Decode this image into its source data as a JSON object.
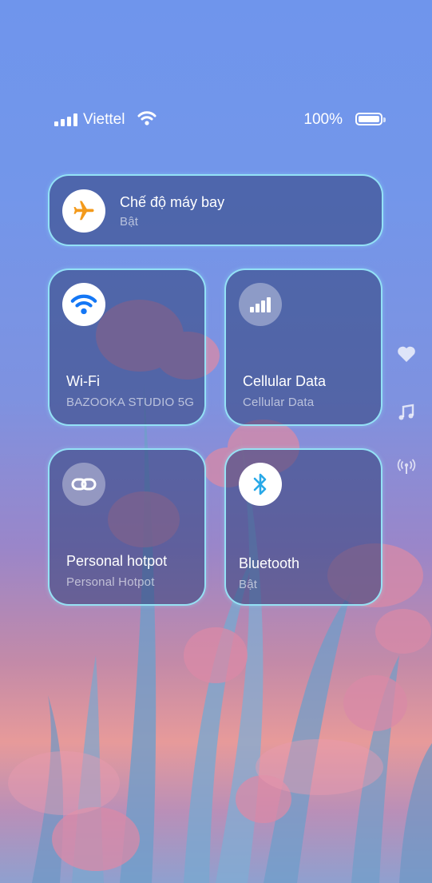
{
  "status_bar": {
    "carrier": "Viettel",
    "battery_percent": "100%",
    "battery_level": 1.0,
    "signal_bars": 4
  },
  "tiles": {
    "airplane": {
      "title": "Chế độ máy bay",
      "subtitle": "Bật",
      "icon": "airplane-icon",
      "icon_color": "#f39a1b"
    },
    "wifi": {
      "title": "Wi-Fi",
      "subtitle": "BAZOOKA STUDIO 5G",
      "icon": "wifi-icon",
      "icon_color": "#1477f5"
    },
    "cellular": {
      "title": "Cellular Data",
      "subtitle": "Cellular Data",
      "icon": "cellular-signal-icon"
    },
    "hotspot": {
      "title": "Personal hotpot",
      "subtitle": "Personal Hotpot",
      "icon": "link-icon"
    },
    "bluetooth": {
      "title": "Bluetooth",
      "subtitle": "Bật",
      "icon": "bluetooth-icon",
      "icon_color": "#29a9e8"
    }
  },
  "side_shortcuts": [
    "heart-icon",
    "music-note-icon",
    "broadcast-icon"
  ],
  "colors": {
    "tile_border": "#9bf0ff",
    "tile_bg": "rgba(48,64,120,0.55)"
  }
}
